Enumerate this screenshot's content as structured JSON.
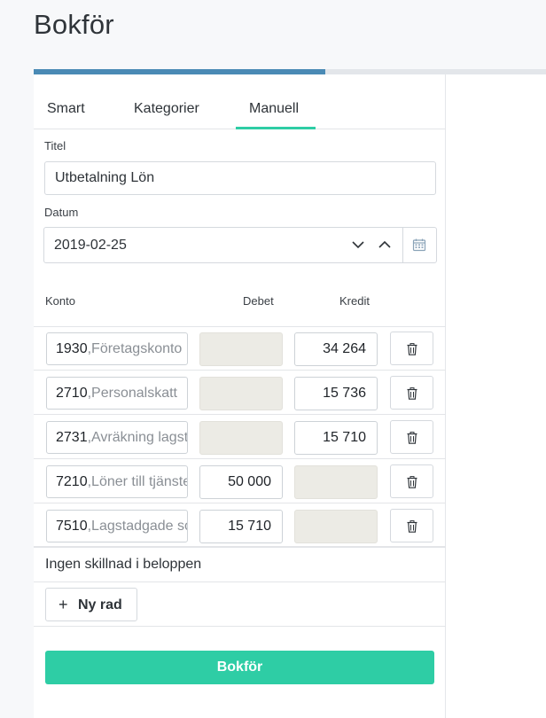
{
  "page_title": "Bokför",
  "progress": {
    "percent": 57
  },
  "tabs": [
    {
      "label": "Smart",
      "active": false
    },
    {
      "label": "Kategorier",
      "active": false
    },
    {
      "label": "Manuell",
      "active": true
    }
  ],
  "form": {
    "title_label": "Titel",
    "title_value": "Utbetalning Lön",
    "date_label": "Datum",
    "date_value": "2019-02-25"
  },
  "columns": {
    "konto": "Konto",
    "debet": "Debet",
    "kredit": "Kredit"
  },
  "rows": [
    {
      "account": "1930",
      "name": "Företagskonto",
      "debet": "",
      "kredit": "34 264"
    },
    {
      "account": "2710",
      "name": "Personalskatt",
      "debet": "",
      "kredit": "15 736"
    },
    {
      "account": "2731",
      "name": "Avräkning lagstadgade",
      "debet": "",
      "kredit": "15 710"
    },
    {
      "account": "7210",
      "name": "Löner till tjänstemän",
      "debet": "50 000",
      "kredit": ""
    },
    {
      "account": "7510",
      "name": "Lagstadgade sociala",
      "debet": "15 710",
      "kredit": ""
    }
  ],
  "difference_text": "Ingen skillnad i beloppen",
  "add_row_label": "Ny rad",
  "submit_label": "Bokför",
  "colors": {
    "accent": "#2ecda5",
    "progress": "#4a8ab5",
    "disabled_field": "#ecebe5"
  },
  "icons": {
    "delete": "trash-icon",
    "calendar": "calendar-icon",
    "add": "plus-icon"
  }
}
